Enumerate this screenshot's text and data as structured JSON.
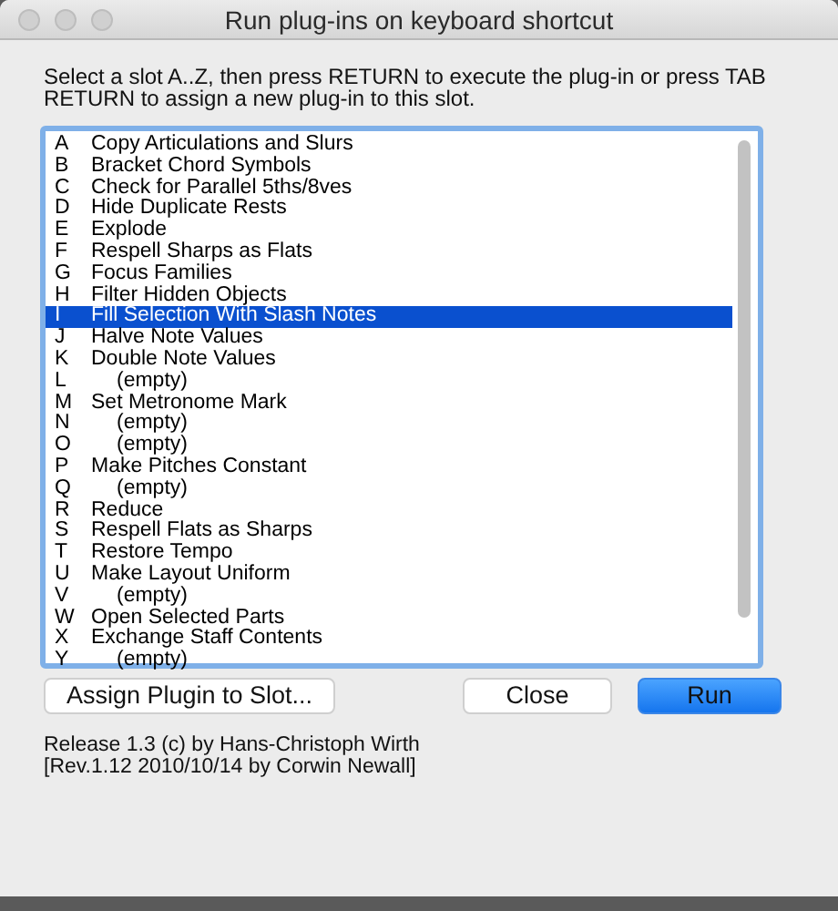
{
  "window": {
    "title": "Run plug-ins on keyboard shortcut"
  },
  "instructions": "Select a slot A..Z, then press RETURN to execute the plug-in or press TAB RETURN to assign a new plug-in to this slot.",
  "slots": [
    {
      "key": "A",
      "name": "Copy Articulations and Slurs",
      "kind": "plugin",
      "selected": false
    },
    {
      "key": "B",
      "name": "Bracket Chord Symbols",
      "kind": "plugin",
      "selected": false
    },
    {
      "key": "C",
      "name": "Check for Parallel 5ths/8ves",
      "kind": "plugin",
      "selected": false
    },
    {
      "key": "D",
      "name": "Hide Duplicate Rests",
      "kind": "plugin",
      "selected": false
    },
    {
      "key": "E",
      "name": "Explode",
      "kind": "plugin",
      "selected": false
    },
    {
      "key": "F",
      "name": "Respell Sharps as Flats",
      "kind": "plugin",
      "selected": false
    },
    {
      "key": "G",
      "name": "Focus Families",
      "kind": "plugin",
      "selected": false
    },
    {
      "key": "H",
      "name": "Filter Hidden Objects",
      "kind": "plugin",
      "selected": false
    },
    {
      "key": "I",
      "name": "Fill Selection With Slash Notes",
      "kind": "plugin",
      "selected": true
    },
    {
      "key": "J",
      "name": "Halve Note Values",
      "kind": "plugin",
      "selected": false
    },
    {
      "key": "K",
      "name": "Double Note Values",
      "kind": "plugin",
      "selected": false
    },
    {
      "key": "L",
      "name": "(empty)",
      "kind": "empty",
      "selected": false
    },
    {
      "key": "M",
      "name": "Set Metronome Mark",
      "kind": "plugin",
      "selected": false
    },
    {
      "key": "N",
      "name": "(empty)",
      "kind": "empty",
      "selected": false
    },
    {
      "key": "O",
      "name": "(empty)",
      "kind": "empty",
      "selected": false
    },
    {
      "key": "P",
      "name": "Make Pitches Constant",
      "kind": "plugin",
      "selected": false
    },
    {
      "key": "Q",
      "name": "(empty)",
      "kind": "empty",
      "selected": false
    },
    {
      "key": "R",
      "name": "Reduce",
      "kind": "plugin",
      "selected": false
    },
    {
      "key": "S",
      "name": "Respell Flats as Sharps",
      "kind": "plugin",
      "selected": false
    },
    {
      "key": "T",
      "name": "Restore Tempo",
      "kind": "plugin",
      "selected": false
    },
    {
      "key": "U",
      "name": "Make Layout Uniform",
      "kind": "plugin",
      "selected": false
    },
    {
      "key": "V",
      "name": "(empty)",
      "kind": "empty",
      "selected": false
    },
    {
      "key": "W",
      "name": "Open Selected Parts",
      "kind": "plugin",
      "selected": false
    },
    {
      "key": "X",
      "name": "Exchange Staff Contents",
      "kind": "plugin",
      "selected": false
    },
    {
      "key": "Y",
      "name": "(empty)",
      "kind": "empty",
      "selected": false
    }
  ],
  "buttons": [
    {
      "label": "Assign Plugin to Slot...",
      "kind": "plain"
    },
    {
      "label": "Close",
      "kind": "plain"
    },
    {
      "label": "Run",
      "kind": "default"
    }
  ],
  "footer": [
    "Release 1.3  (c) by Hans-Christoph Wirth",
    "[Rev.1.12 2010/10/14 by Corwin Newall]"
  ]
}
